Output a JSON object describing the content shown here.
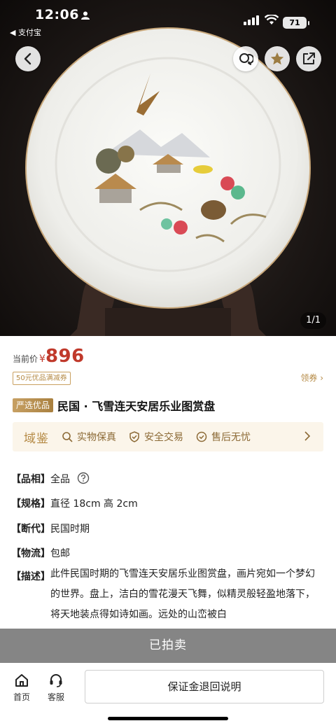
{
  "status_bar": {
    "time": "12:06",
    "back_app": "◀ 支付宝",
    "battery": "71"
  },
  "gallery": {
    "counter": "1/1"
  },
  "price": {
    "label": "当前价",
    "currency": "¥",
    "value": "896"
  },
  "coupon": {
    "tag": "50元优品满减券",
    "action": "领券 ›"
  },
  "title": {
    "badge": "严选优品",
    "text": "民国 · 飞雪连天安居乐业图赏盘"
  },
  "guarantee": {
    "brand": "域鉴",
    "items": [
      "实物保真",
      "安全交易",
      "售后无忧"
    ]
  },
  "attributes": [
    {
      "key": "【品相】",
      "value": "全品"
    },
    {
      "key": "【规格】",
      "value": "直径 18cm 高 2cm"
    },
    {
      "key": "【断代】",
      "value": "民国时期"
    },
    {
      "key": "【物流】",
      "value": "包邮"
    }
  ],
  "description": {
    "key": "【描述】",
    "value": "此件民国时期的飞雪连天安居乐业图赏盘，画片宛如一个梦幻的世界。盘上，洁白的雪花漫天飞舞，似精灵般轻盈地落下，将天地装点得如诗如画。远处的山峦被白"
  },
  "bottom": {
    "sold_label": "已拍卖",
    "home_label": "首页",
    "service_label": "客服",
    "deposit_label": "保证金退回说明"
  },
  "colors": {
    "price": "#c0392b",
    "gold": "#b58a45",
    "sold_bg": "#858585"
  }
}
